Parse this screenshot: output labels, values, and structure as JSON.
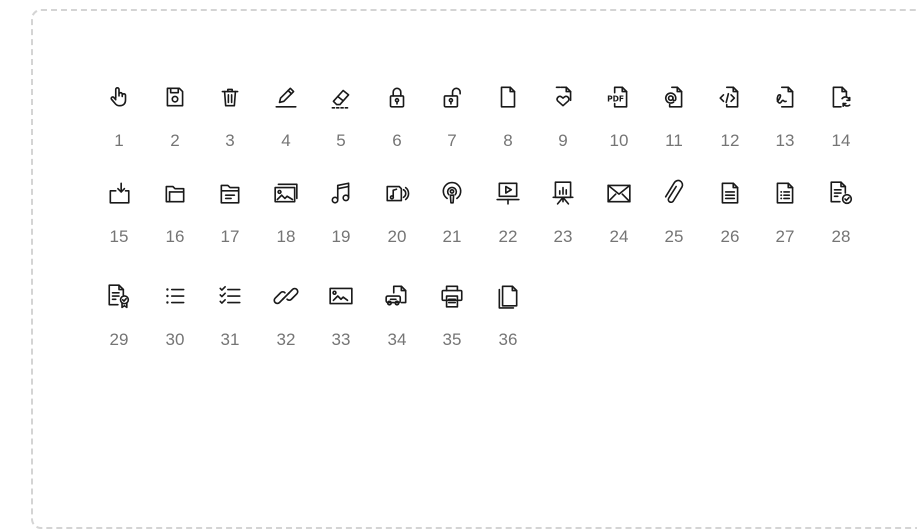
{
  "icons": [
    {
      "num": "1",
      "name": "hand-pointer-icon"
    },
    {
      "num": "2",
      "name": "floppy-disk-icon"
    },
    {
      "num": "3",
      "name": "trash-icon"
    },
    {
      "num": "4",
      "name": "pencil-icon"
    },
    {
      "num": "5",
      "name": "eraser-icon"
    },
    {
      "num": "6",
      "name": "lock-icon"
    },
    {
      "num": "7",
      "name": "unlock-icon"
    },
    {
      "num": "8",
      "name": "blank-file-icon"
    },
    {
      "num": "9",
      "name": "file-heart-icon"
    },
    {
      "num": "10",
      "name": "pdf-file-icon"
    },
    {
      "num": "11",
      "name": "file-at-icon"
    },
    {
      "num": "12",
      "name": "code-file-icon"
    },
    {
      "num": "13",
      "name": "file-signature-icon"
    },
    {
      "num": "14",
      "name": "file-sync-icon"
    },
    {
      "num": "15",
      "name": "folder-download-icon"
    },
    {
      "num": "16",
      "name": "folder-icon"
    },
    {
      "num": "17",
      "name": "folder-document-icon"
    },
    {
      "num": "18",
      "name": "image-gallery-icon"
    },
    {
      "num": "19",
      "name": "music-note-icon"
    },
    {
      "num": "20",
      "name": "audio-file-icon"
    },
    {
      "num": "21",
      "name": "podcast-icon"
    },
    {
      "num": "22",
      "name": "video-presentation-icon"
    },
    {
      "num": "23",
      "name": "chart-presentation-icon"
    },
    {
      "num": "24",
      "name": "envelope-icon"
    },
    {
      "num": "25",
      "name": "paperclip-icon"
    },
    {
      "num": "26",
      "name": "document-icon"
    },
    {
      "num": "27",
      "name": "document-list-icon"
    },
    {
      "num": "28",
      "name": "document-check-icon"
    },
    {
      "num": "29",
      "name": "certificate-icon"
    },
    {
      "num": "30",
      "name": "bullet-list-icon"
    },
    {
      "num": "31",
      "name": "checklist-icon"
    },
    {
      "num": "32",
      "name": "link-icon"
    },
    {
      "num": "33",
      "name": "image-icon"
    },
    {
      "num": "34",
      "name": "file-transfer-icon"
    },
    {
      "num": "35",
      "name": "printer-icon"
    },
    {
      "num": "36",
      "name": "copy-files-icon"
    }
  ],
  "pdf_text": "PDF",
  "code_text": "</>"
}
